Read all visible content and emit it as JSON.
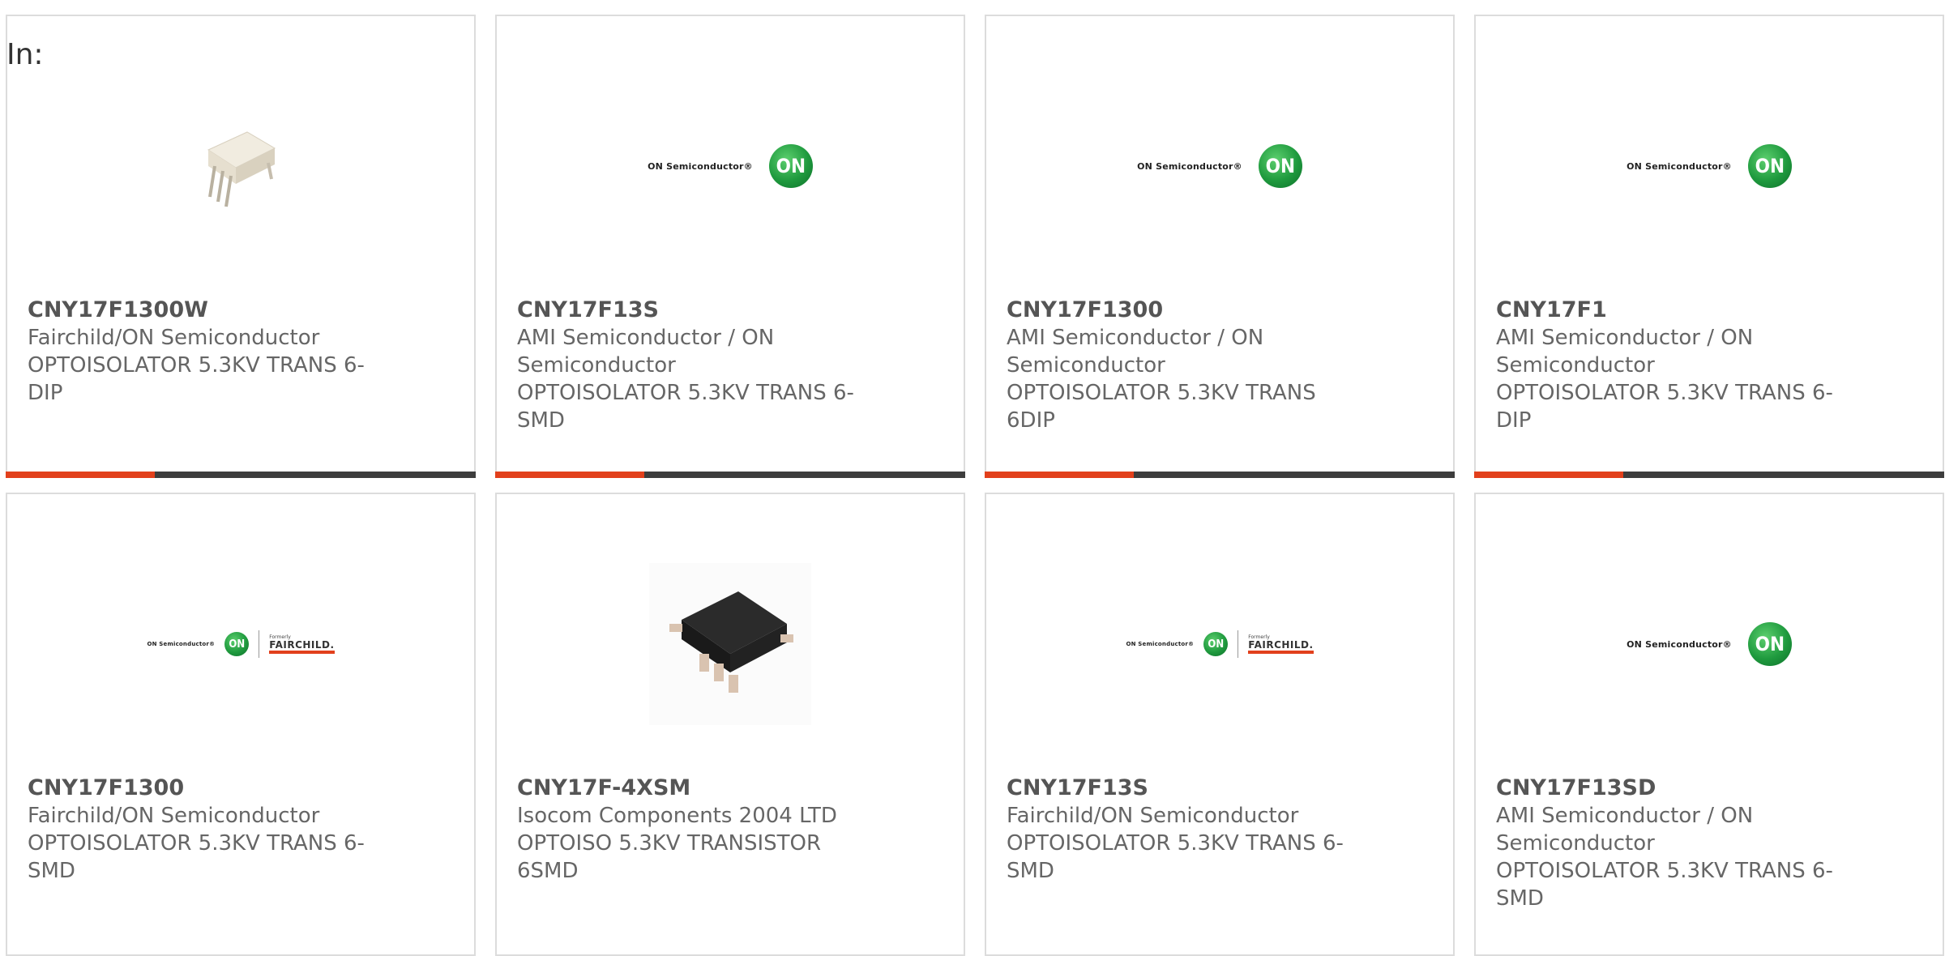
{
  "header": {
    "in_label": "In:"
  },
  "logos": {
    "on_text": "ON Semiconductor®",
    "on_mark": "ON",
    "fairchild_formerly": "Formerly",
    "fairchild_name": "FAIRCHILD."
  },
  "cards": [
    {
      "part": "CNY17F1300W",
      "manufacturer": "Fairchild/ON Semiconductor",
      "description": "OPTOISOLATOR 5.3KV TRANS 6-DIP",
      "image": "dip6-package-photo"
    },
    {
      "part": "CNY17F13S",
      "manufacturer": "AMI Semiconductor / ON Semiconductor",
      "description": "OPTOISOLATOR 5.3KV TRANS 6-SMD",
      "image": "on-semiconductor-logo"
    },
    {
      "part": "CNY17F1300",
      "manufacturer": "AMI Semiconductor / ON Semiconductor",
      "description": "OPTOISOLATOR 5.3KV TRANS 6DIP",
      "image": "on-semiconductor-logo"
    },
    {
      "part": "CNY17F1",
      "manufacturer": "AMI Semiconductor / ON Semiconductor",
      "description": "OPTOISOLATOR 5.3KV TRANS 6-DIP",
      "image": "on-semiconductor-logo"
    },
    {
      "part": "CNY17F1300",
      "manufacturer": "Fairchild/ON Semiconductor",
      "description": "OPTOISOLATOR 5.3KV TRANS 6-SMD",
      "image": "on-fairchild-logo"
    },
    {
      "part": "CNY17F-4XSM",
      "manufacturer": "Isocom Components 2004 LTD",
      "description": "OPTOISO 5.3KV TRANSISTOR 6SMD",
      "image": "smd6-package-photo"
    },
    {
      "part": "CNY17F13S",
      "manufacturer": "Fairchild/ON Semiconductor",
      "description": "OPTOISOLATOR 5.3KV TRANS 6-SMD",
      "image": "on-fairchild-logo"
    },
    {
      "part": "CNY17F13SD",
      "manufacturer": "AMI Semiconductor / ON Semiconductor",
      "description": "OPTOISOLATOR 5.3KV TRANS 6-SMD",
      "image": "on-semiconductor-logo"
    }
  ],
  "colors": {
    "accent": "#e2401c",
    "bar": "#3d3d3d",
    "border": "#dcdcdc",
    "on_green": "#1f9a3e"
  }
}
